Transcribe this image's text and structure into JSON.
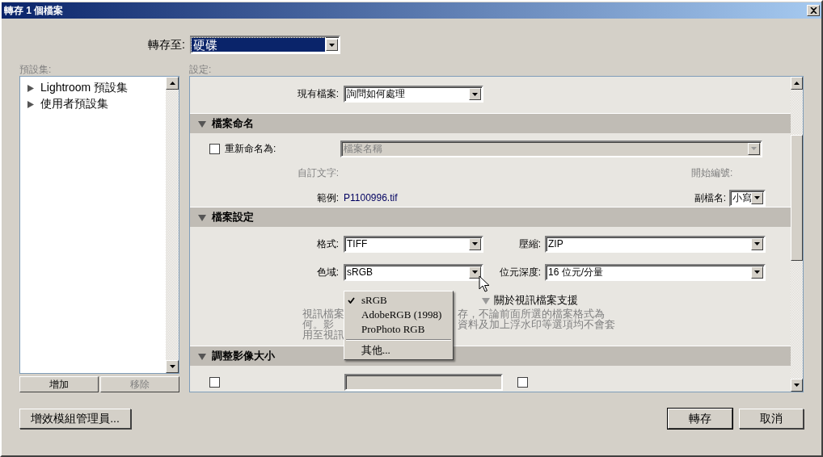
{
  "window": {
    "title": "轉存 1 個檔案"
  },
  "export_to": {
    "label": "轉存至:",
    "value": "硬碟"
  },
  "presets": {
    "label": "預設集:",
    "items": [
      {
        "label": "Lightroom 預設集",
        "expanded": false
      },
      {
        "label": "使用者預設集",
        "expanded": false
      }
    ],
    "buttons": [
      {
        "label": "增加",
        "disabled": false
      },
      {
        "label": "移除",
        "disabled": true
      }
    ]
  },
  "settings": {
    "label": "設定:",
    "existing_files": {
      "label": "現有檔案:",
      "value": "詢問如何處理"
    },
    "file_naming": {
      "title": "檔案命名",
      "expanded": true,
      "rename": {
        "label": "重新命名為:",
        "checked": false,
        "value": "檔案名稱",
        "disabled": true
      },
      "custom_text": {
        "label": "自訂文字:",
        "disabled": true
      },
      "start_number": {
        "label": "開始編號:",
        "disabled": true
      },
      "example": {
        "label": "範例:",
        "value": "P1100996.tif"
      },
      "extension": {
        "label": "副檔名:",
        "value": "小寫"
      }
    },
    "file_settings": {
      "title": "檔案設定",
      "expanded": true,
      "format": {
        "label": "格式:",
        "value": "TIFF"
      },
      "compression": {
        "label": "壓縮:",
        "value": "ZIP"
      },
      "color_space": {
        "label": "色域:",
        "value": "sRGB"
      },
      "bit_depth": {
        "label": "位元深度:",
        "value": "16 位元/分量"
      },
      "video_note": {
        "title": "關於視訊檔案支援",
        "expanded": true,
        "lines_left": [
          "視訊檔案",
          "何。影",
          "用至視訊"
        ],
        "lines_right": [
          "存，不論前面所選的檔案格式為",
          "資料及加上浮水印等選項均不會套"
        ]
      }
    },
    "image_sizing": {
      "title": "調整影像大小",
      "expanded": true,
      "resize_checked": false,
      "dont_enlarge_checked": false
    }
  },
  "color_space_menu": {
    "items": [
      {
        "kind": "option",
        "label": "sRGB",
        "checked": true
      },
      {
        "kind": "option",
        "label": "AdobeRGB (1998)",
        "checked": false
      },
      {
        "kind": "option",
        "label": "ProPhoto RGB",
        "checked": false
      },
      {
        "kind": "separator"
      },
      {
        "kind": "option",
        "label": "其他...",
        "checked": false
      }
    ]
  },
  "footer": {
    "plugin_manager": "增效模組管理員...",
    "export": "轉存",
    "cancel": "取消"
  }
}
